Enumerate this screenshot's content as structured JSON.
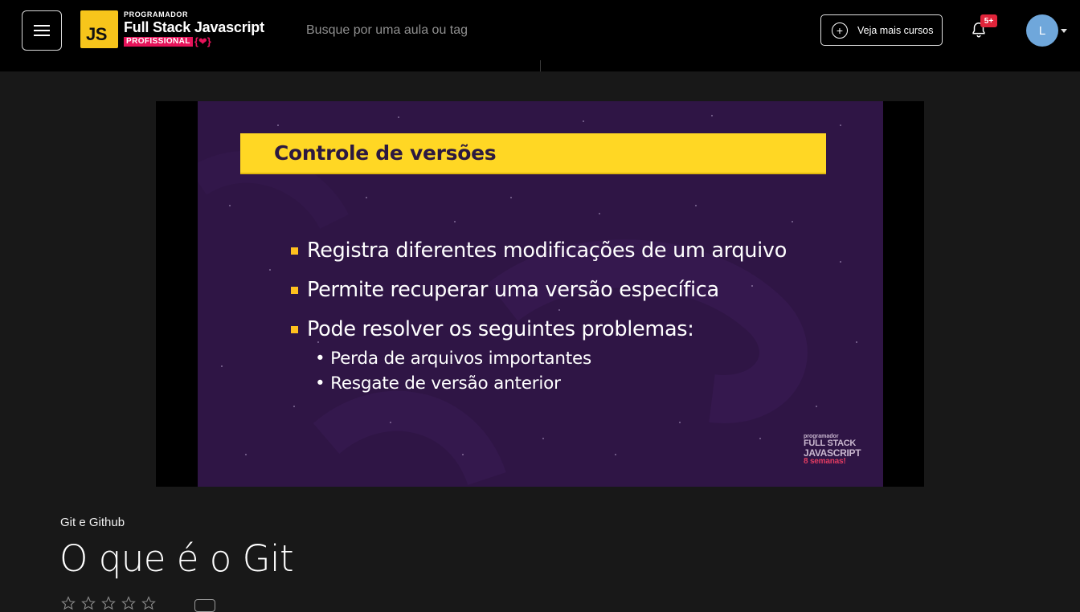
{
  "header": {
    "brand": {
      "badge": "JS",
      "kicker": "PROGRAMADOR",
      "title": "Full Stack Javascript",
      "subtitle": "PROFISSIONAL",
      "braces": "{❤}"
    },
    "search": {
      "placeholder": "Busque por uma aula ou tag",
      "value": ""
    },
    "more_courses_label": "Veja mais cursos",
    "notifications_badge": "5+",
    "avatar_initial": "L",
    "icons": {
      "menu": "hamburger-menu-icon",
      "plus": "plus-circle-icon",
      "bell": "bell-icon",
      "caret": "caret-down-icon"
    }
  },
  "video": {
    "slide": {
      "title": "Controle de versões",
      "bullets": [
        "Registra diferentes modificações de um arquivo",
        "Permite recuperar uma versão específica",
        "Pode resolver os seguintes problemas:"
      ],
      "sub_bullets": [
        "• Perda de arquivos importantes",
        "• Resgate de versão anterior"
      ],
      "logo": {
        "line1": "programador",
        "line2": "FULL STACK",
        "line3": "JAVASCRIPT",
        "line4": "8 semanas!"
      }
    },
    "colors": {
      "slide_bg": "#2f1545",
      "title_bar": "#ffd724",
      "bullet": "#ffc01e"
    }
  },
  "lesson": {
    "course": "Git e Github",
    "title": "O que é o Git",
    "rating_stars": 0,
    "max_stars": 5
  }
}
